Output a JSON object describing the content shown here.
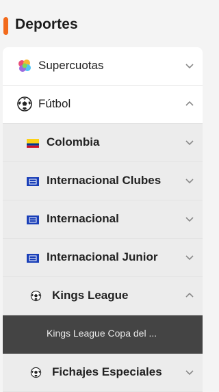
{
  "header": {
    "title": "Deportes",
    "accent_color": "#f26a1b"
  },
  "menu": {
    "items": [
      {
        "label": "Supercuotas",
        "icon": "supercuotas-icon",
        "chevron": "chevron-down-icon"
      },
      {
        "label": "Fútbol",
        "icon": "soccer-ball-icon",
        "chevron": "chevron-up-icon"
      },
      {
        "label": "Colombia",
        "icon": "colombia-flag-icon",
        "chevron": "chevron-down-icon"
      },
      {
        "label": "Internacional Clubes",
        "icon": "world-flag-icon",
        "chevron": "chevron-down-icon"
      },
      {
        "label": "Internacional",
        "icon": "world-flag-icon",
        "chevron": "chevron-down-icon"
      },
      {
        "label": "Internacional Junior",
        "icon": "world-flag-icon",
        "chevron": "chevron-down-icon"
      },
      {
        "label": "Kings League",
        "icon": "soccer-ball-icon",
        "chevron": "chevron-up-icon"
      },
      {
        "label": "Kings League Copa del ..."
      },
      {
        "label": "Fichajes Especiales",
        "icon": "soccer-ball-icon",
        "chevron": "chevron-down-icon"
      }
    ]
  }
}
